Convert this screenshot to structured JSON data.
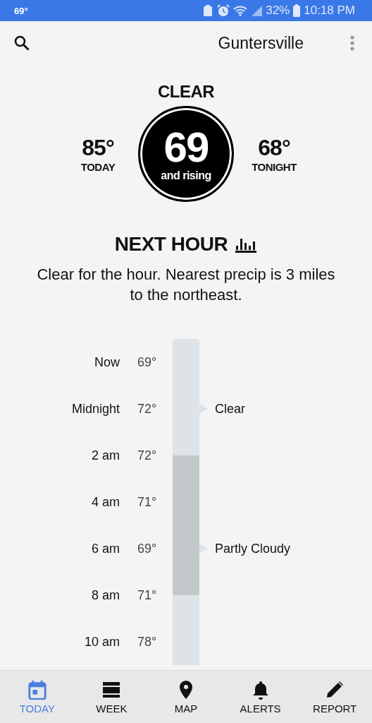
{
  "status_bar": {
    "temperature": "69°",
    "battery": "32%",
    "time": "10:18 PM"
  },
  "header": {
    "location": "Guntersville"
  },
  "current": {
    "condition": "CLEAR",
    "temperature": "69",
    "trend": "and rising",
    "high": {
      "value": "85°",
      "label": "TODAY"
    },
    "low": {
      "value": "68°",
      "label": "TONIGHT"
    }
  },
  "next_hour": {
    "title": "NEXT HOUR",
    "summary": "Clear for the hour. Nearest precip is 3 miles to the northeast."
  },
  "timeline": [
    {
      "time": "Now",
      "temperature": "69°",
      "cloudy": [
        false,
        false
      ]
    },
    {
      "time": "Midnight",
      "temperature": "72°",
      "cloudy": [
        false,
        false
      ],
      "condition": "Clear"
    },
    {
      "time": "2 am",
      "temperature": "72°",
      "cloudy": [
        false,
        true
      ]
    },
    {
      "time": "4 am",
      "temperature": "71°",
      "cloudy": [
        true,
        true
      ]
    },
    {
      "time": "6 am",
      "temperature": "69°",
      "cloudy": [
        true,
        true
      ],
      "condition": "Partly Cloudy"
    },
    {
      "time": "8 am",
      "temperature": "71°",
      "cloudy": [
        true,
        false
      ]
    },
    {
      "time": "10 am",
      "temperature": "78°",
      "cloudy": [
        false,
        false
      ]
    }
  ],
  "nav": [
    {
      "kind": "calendar",
      "label": "TODAY",
      "selected": true
    },
    {
      "kind": "week",
      "label": "WEEK",
      "selected": false
    },
    {
      "kind": "map",
      "label": "MAP",
      "selected": false
    },
    {
      "kind": "alerts",
      "label": "ALERTS",
      "selected": false
    },
    {
      "kind": "report",
      "label": "REPORT",
      "selected": false
    }
  ]
}
